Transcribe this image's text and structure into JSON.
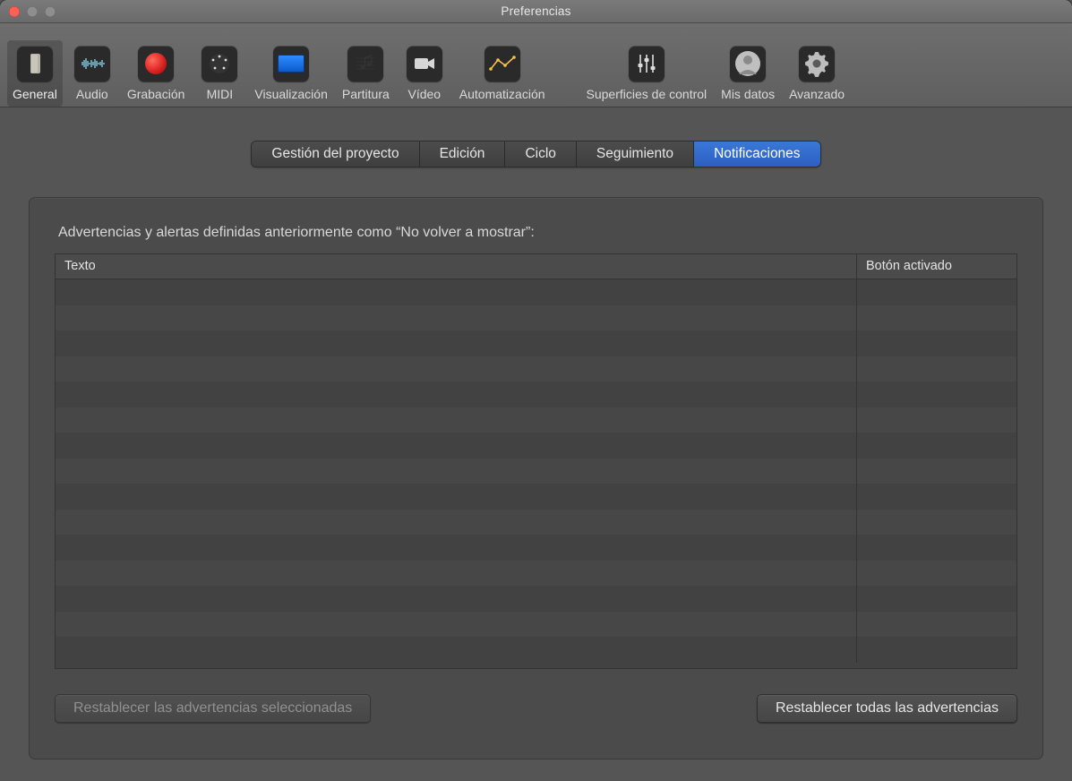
{
  "window": {
    "title": "Preferencias"
  },
  "toolbar": {
    "items": [
      {
        "id": "general",
        "label": "General",
        "icon": "switch-icon",
        "active": true
      },
      {
        "id": "audio",
        "label": "Audio",
        "icon": "waveform-icon",
        "active": false
      },
      {
        "id": "rec",
        "label": "Grabación",
        "icon": "record-icon",
        "active": false
      },
      {
        "id": "midi",
        "label": "MIDI",
        "icon": "midi-icon",
        "active": false
      },
      {
        "id": "display",
        "label": "Visualización",
        "icon": "monitor-icon",
        "active": false
      },
      {
        "id": "score",
        "label": "Partitura",
        "icon": "score-icon",
        "active": false
      },
      {
        "id": "video",
        "label": "Vídeo",
        "icon": "camera-icon",
        "active": false
      },
      {
        "id": "auto",
        "label": "Automatización",
        "icon": "automation-icon",
        "active": false
      },
      {
        "id": "surf",
        "label": "Superficies de control",
        "icon": "faders-icon",
        "active": false
      },
      {
        "id": "user",
        "label": "Mis datos",
        "icon": "user-icon",
        "active": false
      },
      {
        "id": "adv",
        "label": "Avanzado",
        "icon": "gear-icon",
        "active": false
      }
    ]
  },
  "tabs": {
    "items": [
      {
        "id": "proj",
        "label": "Gestión del proyecto",
        "active": false
      },
      {
        "id": "edit",
        "label": "Edición",
        "active": false
      },
      {
        "id": "cycle",
        "label": "Ciclo",
        "active": false
      },
      {
        "id": "follow",
        "label": "Seguimiento",
        "active": false
      },
      {
        "id": "notif",
        "label": "Notificaciones",
        "active": true
      }
    ]
  },
  "panel": {
    "lead": "Advertencias y alertas definidas anteriormente como “No volver a mostrar”:",
    "columns": {
      "text": "Texto",
      "button": "Botón activado"
    },
    "rows": []
  },
  "buttons": {
    "reset_selected": "Restablecer las advertencias seleccionadas",
    "reset_all": "Restablecer todas las advertencias"
  }
}
